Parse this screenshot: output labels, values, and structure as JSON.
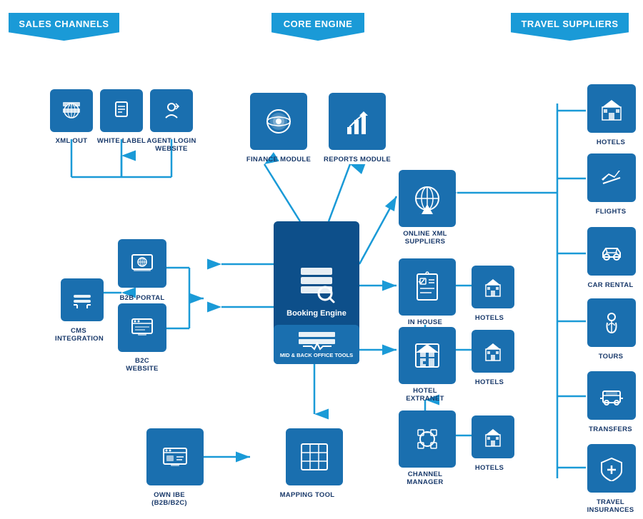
{
  "headers": {
    "sales_channels": "SALES CHANNELS",
    "core_engine": "CORE ENGINE",
    "travel_suppliers": "TRAVEL SUPPLIERS"
  },
  "sales_channel_items": [
    {
      "id": "xml-out",
      "label": "XML OUT"
    },
    {
      "id": "white-label",
      "label": "WHITE LABEL"
    },
    {
      "id": "agent-login",
      "label": "AGENT LOGIN\nWEBSITE"
    },
    {
      "id": "b2b-portal",
      "label": "B2B PORTAL"
    },
    {
      "id": "b2c-website",
      "label": "B2C WEBSITE"
    },
    {
      "id": "cms-integration",
      "label": "CMS\nINTEGRATION"
    },
    {
      "id": "own-ibe",
      "label": "OWN IBE\n(B2B/B2C)"
    }
  ],
  "core_engine_items": [
    {
      "id": "finance-module",
      "label": "FINANCE MODULE"
    },
    {
      "id": "reports-module",
      "label": "REPORTS MODULE"
    },
    {
      "id": "booking-engine",
      "label": "Booking Engine"
    },
    {
      "id": "mid-back-office",
      "label": "MID & BACK OFFICE TOOLS"
    },
    {
      "id": "mapping-tool",
      "label": "MAPPING TOOL"
    }
  ],
  "middle_items": [
    {
      "id": "online-xml",
      "label": "ONLINE XML\nSUPPLIERS"
    },
    {
      "id": "in-house-contracts",
      "label": "IN HOUSE\nCONTRACTS"
    },
    {
      "id": "hotels-middle-1",
      "label": "HOTELS"
    },
    {
      "id": "hotel-extranet",
      "label": "HOTEL\nEXTRANET"
    },
    {
      "id": "hotels-middle-2",
      "label": "HOTELS"
    },
    {
      "id": "channel-manager",
      "label": "CHANNEL\nMANAGER"
    },
    {
      "id": "hotels-middle-3",
      "label": "HOTELS"
    }
  ],
  "travel_supplier_items": [
    {
      "id": "hotels",
      "label": "HOTELS"
    },
    {
      "id": "flights",
      "label": "FLIGHTS"
    },
    {
      "id": "car-rental",
      "label": "CAR RENTAL"
    },
    {
      "id": "tours",
      "label": "TOURS"
    },
    {
      "id": "transfers",
      "label": "TRANSFERS"
    },
    {
      "id": "travel-insurances",
      "label": "TRAVEL\nINSURANCES"
    }
  ]
}
